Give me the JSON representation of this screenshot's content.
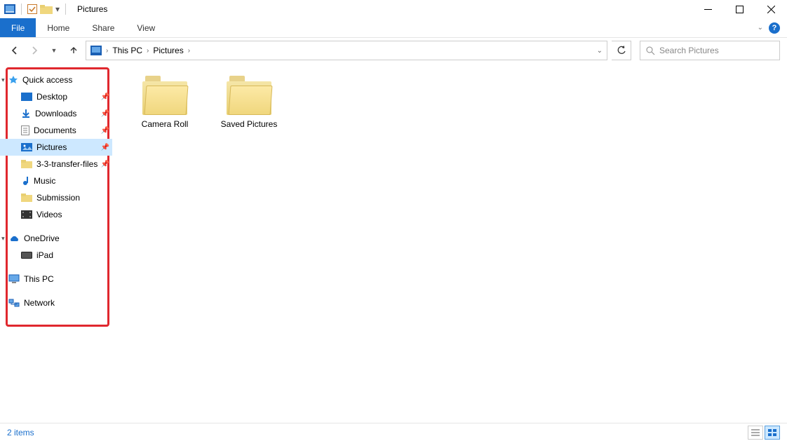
{
  "window": {
    "title": "Pictures"
  },
  "ribbon": {
    "file": "File",
    "tabs": [
      "Home",
      "Share",
      "View"
    ]
  },
  "breadcrumb": [
    "This PC",
    "Pictures"
  ],
  "search": {
    "placeholder": "Search Pictures"
  },
  "nav": {
    "quick_access": "Quick access",
    "items": [
      {
        "label": "Desktop",
        "icon": "desktop",
        "pinned": true
      },
      {
        "label": "Downloads",
        "icon": "download",
        "pinned": true
      },
      {
        "label": "Documents",
        "icon": "document",
        "pinned": true
      },
      {
        "label": "Pictures",
        "icon": "pictures",
        "pinned": true,
        "selected": true
      },
      {
        "label": "3-3-transfer-files",
        "icon": "folder",
        "pinned": true
      },
      {
        "label": "Music",
        "icon": "music",
        "pinned": false
      },
      {
        "label": "Submission",
        "icon": "folder",
        "pinned": false
      },
      {
        "label": "Videos",
        "icon": "video",
        "pinned": false
      }
    ],
    "onedrive": "OneDrive",
    "onedrive_items": [
      {
        "label": "iPad"
      }
    ],
    "thispc": "This PC",
    "network": "Network"
  },
  "folders": [
    {
      "name": "Camera Roll"
    },
    {
      "name": "Saved Pictures"
    }
  ],
  "status": {
    "text": "2 items"
  }
}
